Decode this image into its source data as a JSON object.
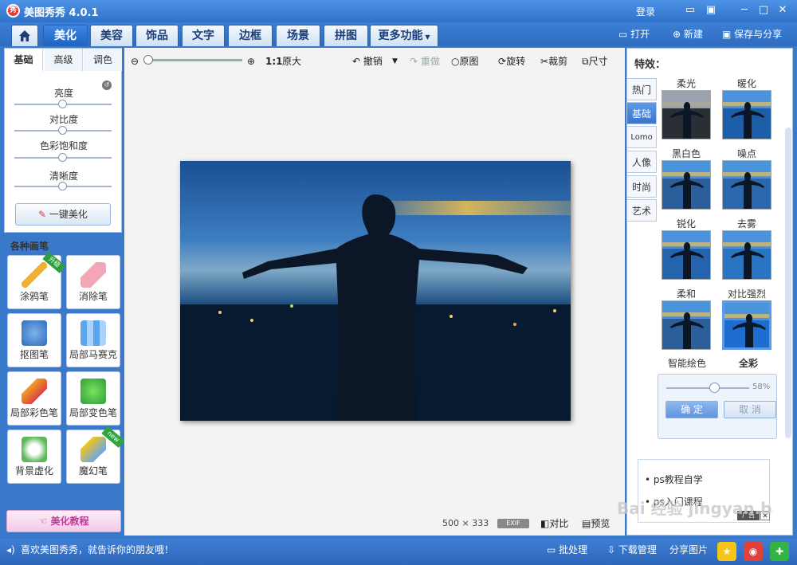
{
  "window": {
    "title": "美图秀秀 4.0.1",
    "login": "登录",
    "logo_char": "秀"
  },
  "tabs": [
    {
      "label": "美化"
    },
    {
      "label": "美容"
    },
    {
      "label": "饰品"
    },
    {
      "label": "文字"
    },
    {
      "label": "边框"
    },
    {
      "label": "场景"
    },
    {
      "label": "拼图"
    },
    {
      "label": "更多功能"
    }
  ],
  "file_actions": {
    "open": "打开",
    "new": "新建",
    "save": "保存与分享"
  },
  "left_panel": {
    "tabs": [
      "基础",
      "高级",
      "调色"
    ],
    "sliders": [
      {
        "label": "亮度",
        "value": 0.5
      },
      {
        "label": "对比度",
        "value": 0.5
      },
      {
        "label": "色彩饱和度",
        "value": 0.5
      },
      {
        "label": "清晰度",
        "value": 0.5
      }
    ],
    "onekey_label": "一键美化",
    "brushes_title": "各种画笔",
    "brushes": [
      {
        "label": "涂鸦笔",
        "badge": "升级"
      },
      {
        "label": "消除笔"
      },
      {
        "label": "抠图笔"
      },
      {
        "label": "局部马赛克"
      },
      {
        "label": "局部彩色笔"
      },
      {
        "label": "局部变色笔"
      },
      {
        "label": "背景虚化"
      },
      {
        "label": "魔幻笔",
        "badge": "new"
      }
    ],
    "tutorial_label": "美化教程"
  },
  "canvas_toolbar": {
    "zoom_ratio": "1:1",
    "original_size": "原大",
    "undo": "撤销",
    "redo": "重做",
    "original": "原图",
    "rotate": "旋转",
    "crop": "裁剪",
    "resize": "尺寸"
  },
  "image_info": {
    "width": "500",
    "times": "×",
    "height": "333",
    "exif": "EXIF",
    "compare": "对比",
    "preview": "预览"
  },
  "right_panel": {
    "title": "特效：",
    "categories": [
      "热门",
      "基础",
      "Lomo",
      "人像",
      "时尚",
      "艺术"
    ],
    "active_category": "基础",
    "effects": [
      {
        "label": "柔光"
      },
      {
        "label": "暖化"
      },
      {
        "label": "黑白色"
      },
      {
        "label": "噪点"
      },
      {
        "label": "锐化"
      },
      {
        "label": "去雾"
      },
      {
        "label": "柔和"
      },
      {
        "label": "对比强烈"
      }
    ],
    "bottom_labels": [
      "智能绘色",
      "全彩"
    ],
    "strength_percent": "58%",
    "strength_value": 0.58,
    "confirm": "确 定",
    "cancel": "取 消",
    "ad_items": [
      "ps教程自学",
      "ps入门课程"
    ],
    "ad_tag": "广告"
  },
  "statusbar": {
    "message": "喜欢美图秀秀，就告诉你的朋友哦！",
    "batch": "批处理",
    "download": "下载管理",
    "share": "分享图片"
  },
  "watermark": "Bai 经验 jingyan.baidu.com",
  "colors": {
    "titlebar": "#2f71c9",
    "accent": "#3a74c7",
    "selected_border": "#5d9ae9"
  }
}
